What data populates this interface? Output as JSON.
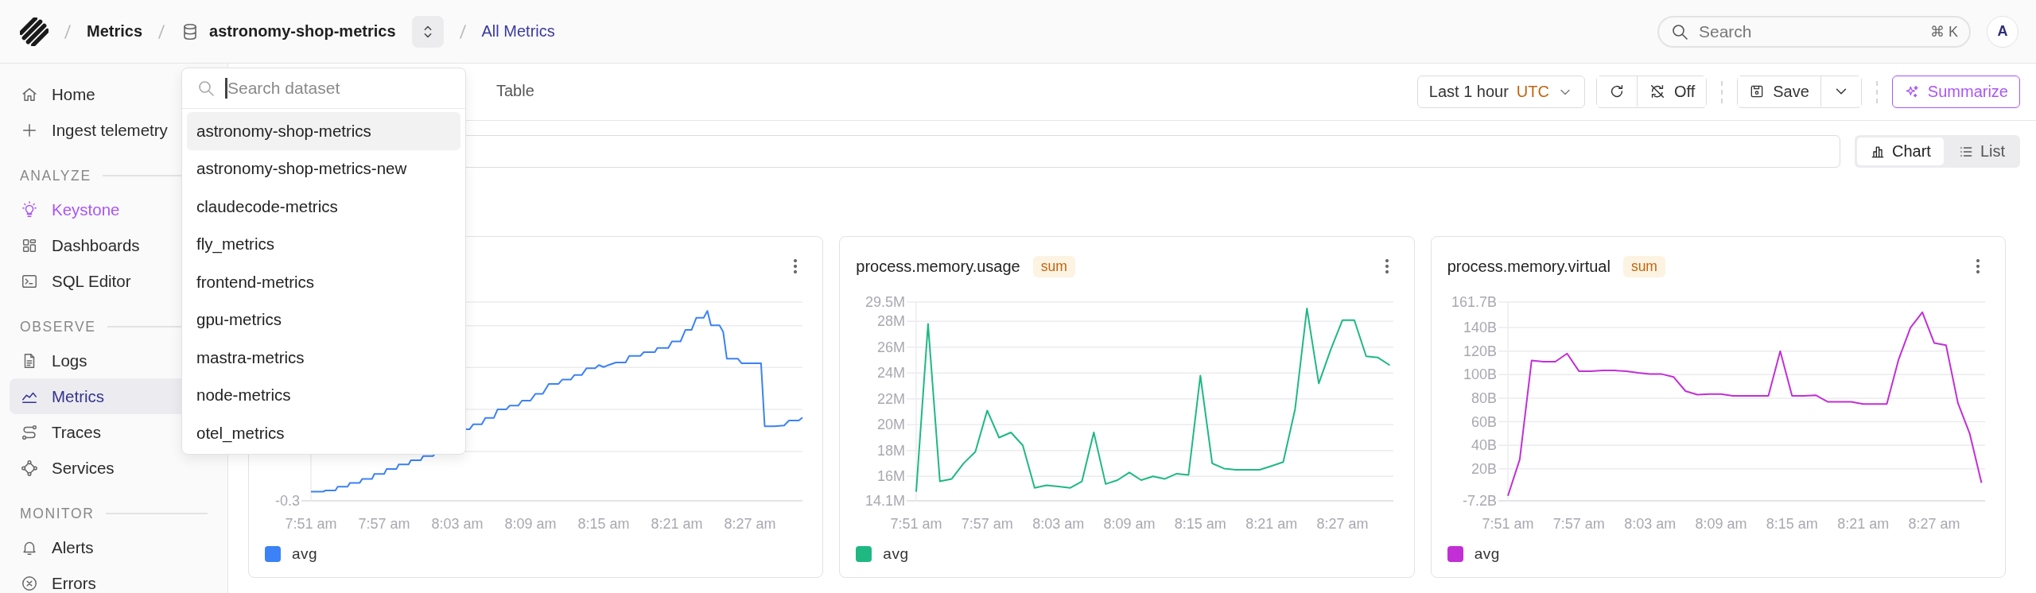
{
  "breadcrumbs": [
    {
      "label": "Metrics",
      "kind": "link"
    },
    {
      "label": "astronomy-shop-metrics",
      "kind": "dataset"
    },
    {
      "label": "All Metrics",
      "kind": "current"
    }
  ],
  "global_search": {
    "placeholder": "Search",
    "shortcut": "⌘ K"
  },
  "avatar": {
    "initial": "A"
  },
  "sidebar": {
    "items": [
      {
        "label": "Home",
        "selected": false,
        "accent": false
      },
      {
        "label": "Ingest telemetry",
        "selected": false,
        "accent": false
      }
    ],
    "sections": [
      {
        "title": "ANALYZE",
        "items": [
          {
            "label": "Keystone",
            "selected": false,
            "accent": true
          },
          {
            "label": "Dashboards",
            "selected": false,
            "accent": false
          },
          {
            "label": "SQL Editor",
            "selected": false,
            "accent": false
          }
        ]
      },
      {
        "title": "OBSERVE",
        "items": [
          {
            "label": "Logs",
            "selected": false,
            "accent": false
          },
          {
            "label": "Metrics",
            "selected": true,
            "accent": false
          },
          {
            "label": "Traces",
            "selected": false,
            "accent": false
          },
          {
            "label": "Services",
            "selected": false,
            "accent": false
          }
        ]
      },
      {
        "title": "MONITOR",
        "items": [
          {
            "label": "Alerts",
            "selected": false,
            "accent": false
          },
          {
            "label": "Errors",
            "selected": false,
            "accent": false
          }
        ]
      }
    ]
  },
  "tabs": [
    {
      "label": "Table",
      "selected": false
    }
  ],
  "toolbar": {
    "time_range": "Last 1 hour",
    "timezone": "UTC",
    "auto_refresh": "Off",
    "save": "Save",
    "summarize": "Summarize"
  },
  "view_toggle": [
    {
      "label": "Chart",
      "selected": true
    },
    {
      "label": "List",
      "selected": false
    }
  ],
  "cards": [
    {
      "kind": "picture",
      "legend": {
        "label": "avg",
        "color": "#3b82f6"
      },
      "y_tick_labels": [
        "-0.3"
      ],
      "x_tick_labels": [
        "7:51 am",
        "7:57 am",
        "8:03 am",
        "8:09 am",
        "8:15 am",
        "8:21 am",
        "8:27 am"
      ]
    },
    {
      "kind": "chart",
      "title": "process.memory.usage",
      "aggregation": "sum",
      "chart_data": {
        "type": "line",
        "categories": [
          "7:51 am",
          null,
          null,
          null,
          null,
          null,
          "7:57 am",
          null,
          null,
          null,
          null,
          null,
          "8:03 am",
          null,
          null,
          null,
          null,
          null,
          "8:09 am",
          null,
          null,
          null,
          null,
          null,
          "8:15 am",
          null,
          null,
          null,
          null,
          null,
          "8:21 am",
          null,
          null,
          null,
          null,
          null,
          "8:27 am",
          null,
          null,
          null,
          null
        ],
        "ylim": [
          14.1,
          29.5
        ],
        "grid": true,
        "yticks": [
          {
            "value": 14.1,
            "label": "14.1M"
          },
          {
            "value": 16,
            "label": "16M"
          },
          {
            "value": 18,
            "label": "18M"
          },
          {
            "value": 20,
            "label": "20M"
          },
          {
            "value": 22,
            "label": "22M"
          },
          {
            "value": 24,
            "label": "24M"
          },
          {
            "value": 26,
            "label": "26M"
          },
          {
            "value": 28,
            "label": "28M"
          },
          {
            "value": 29.5,
            "label": "29.5M"
          }
        ],
        "series": [
          {
            "name": "avg",
            "color": "#1fb883",
            "values": [
              14.8,
              27.8,
              15.6,
              15.8,
              17.0,
              17.9,
              21.1,
              19.0,
              19.4,
              18.4,
              15.1,
              15.3,
              15.2,
              15.1,
              15.6,
              19.4,
              15.4,
              15.7,
              16.3,
              15.7,
              16.0,
              15.8,
              16.2,
              16.1,
              23.8,
              17.0,
              16.6,
              16.5,
              16.5,
              16.5,
              16.8,
              17.1,
              21.2,
              29.0,
              23.2,
              25.8,
              28.1,
              28.1,
              25.3,
              25.2,
              24.6
            ]
          }
        ]
      }
    },
    {
      "kind": "chart",
      "title": "process.memory.virtual",
      "aggregation": "sum",
      "chart_data": {
        "type": "line",
        "categories": [
          "7:51 am",
          null,
          null,
          null,
          null,
          null,
          "7:57 am",
          null,
          null,
          null,
          null,
          null,
          "8:03 am",
          null,
          null,
          null,
          null,
          null,
          "8:09 am",
          null,
          null,
          null,
          null,
          null,
          "8:15 am",
          null,
          null,
          null,
          null,
          null,
          "8:21 am",
          null,
          null,
          null,
          null,
          null,
          "8:27 am",
          null,
          null,
          null,
          null
        ],
        "ylim": [
          -7.2,
          161.7
        ],
        "grid": true,
        "yticks": [
          {
            "value": -7.2,
            "label": "-7.2B"
          },
          {
            "value": 20,
            "label": "20B"
          },
          {
            "value": 40,
            "label": "40B"
          },
          {
            "value": 60,
            "label": "60B"
          },
          {
            "value": 80,
            "label": "80B"
          },
          {
            "value": 100,
            "label": "100B"
          },
          {
            "value": 120,
            "label": "120B"
          },
          {
            "value": 140,
            "label": "140B"
          },
          {
            "value": 161.7,
            "label": "161.7B"
          }
        ],
        "series": [
          {
            "name": "avg",
            "color": "#c22fd6",
            "values": [
              -3,
              28,
              112,
              111,
              111,
              118,
              103,
              103,
              103.5,
              103.5,
              103,
              101.5,
              100.5,
              100.5,
              98,
              86,
              83,
              83.5,
              83.5,
              82,
              82,
              82,
              82,
              120,
              82,
              82,
              82.5,
              77,
              77,
              77,
              75,
              75,
              75,
              113,
              140,
              153,
              127,
              125,
              76,
              50,
              8
            ]
          }
        ]
      }
    }
  ],
  "dataset_menu": {
    "placeholder": "Search dataset",
    "options": [
      {
        "label": "astronomy-shop-metrics",
        "selected": true
      },
      {
        "label": "astronomy-shop-metrics-new",
        "selected": false
      },
      {
        "label": "claudecode-metrics",
        "selected": false
      },
      {
        "label": "fly_metrics",
        "selected": false
      },
      {
        "label": "frontend-metrics",
        "selected": false
      },
      {
        "label": "gpu-metrics",
        "selected": false
      },
      {
        "label": "mastra-metrics",
        "selected": false
      },
      {
        "label": "node-metrics",
        "selected": false
      },
      {
        "label": "otel_metrics",
        "selected": false
      }
    ]
  }
}
